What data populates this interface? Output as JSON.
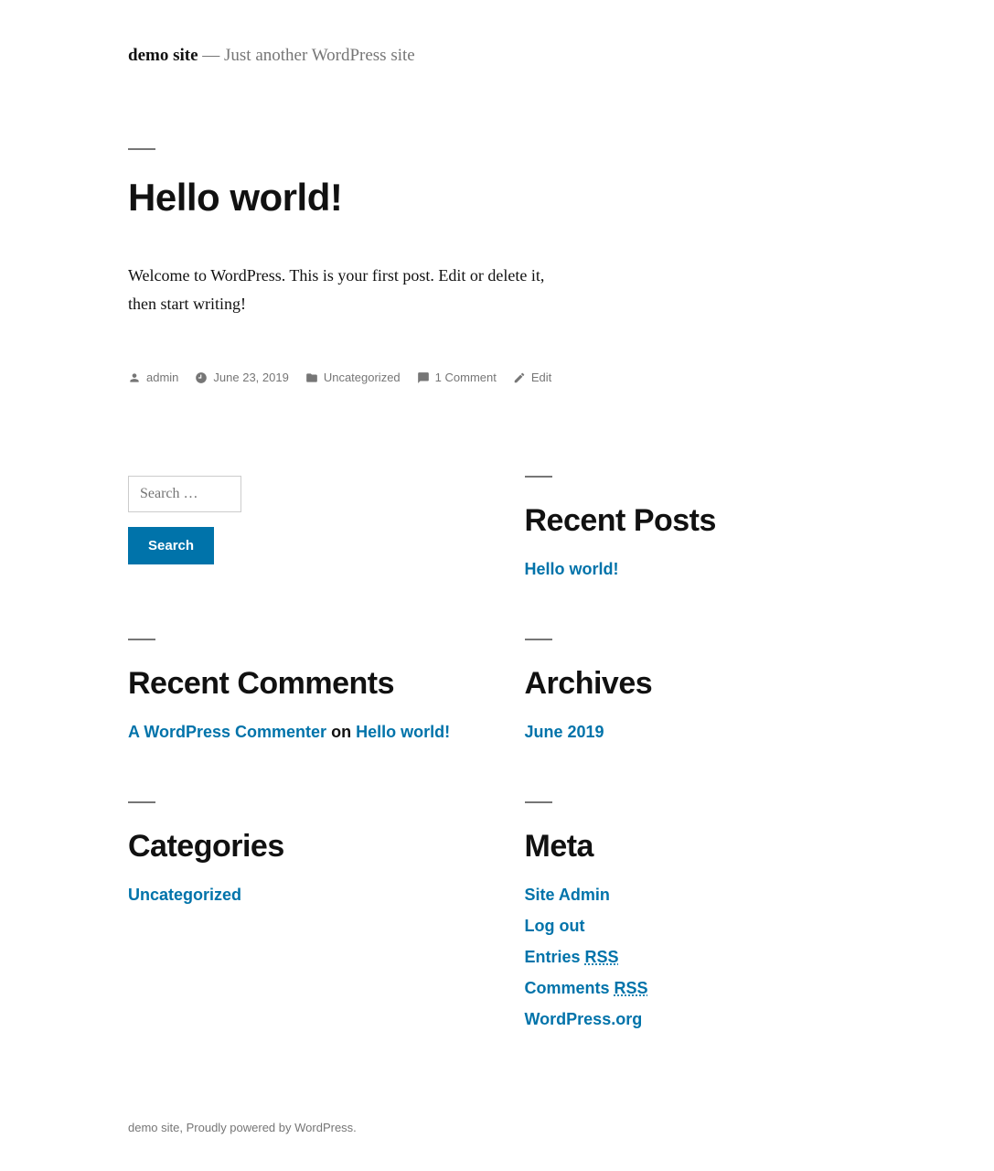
{
  "header": {
    "site_title": "demo site",
    "separator": "—",
    "tagline": "Just another WordPress site"
  },
  "post": {
    "title": "Hello world!",
    "content": "Welcome to WordPress. This is your first post. Edit or delete it, then start writing!",
    "meta": {
      "author": "admin",
      "date": "June 23, 2019",
      "category": "Uncategorized",
      "comments": "1 Comment",
      "edit": "Edit"
    }
  },
  "widgets": {
    "search": {
      "placeholder": "Search …",
      "button": "Search"
    },
    "recent_posts": {
      "title": "Recent Posts",
      "items": [
        "Hello world!"
      ]
    },
    "recent_comments": {
      "title": "Recent Comments",
      "items": [
        {
          "author": "A WordPress Commenter",
          "on": "on",
          "post": "Hello world!"
        }
      ]
    },
    "archives": {
      "title": "Archives",
      "items": [
        "June 2019"
      ]
    },
    "categories": {
      "title": "Categories",
      "items": [
        "Uncategorized"
      ]
    },
    "meta": {
      "title": "Meta",
      "items": [
        {
          "text": "Site Admin"
        },
        {
          "text": "Log out"
        },
        {
          "prefix": "Entries ",
          "abbr": "RSS"
        },
        {
          "prefix": "Comments ",
          "abbr": "RSS"
        },
        {
          "text": "WordPress.org"
        }
      ]
    }
  },
  "footer": {
    "site_link": "demo site",
    "sep": ", ",
    "credit": "Proudly powered by WordPress.",
    "credit_period": " "
  }
}
